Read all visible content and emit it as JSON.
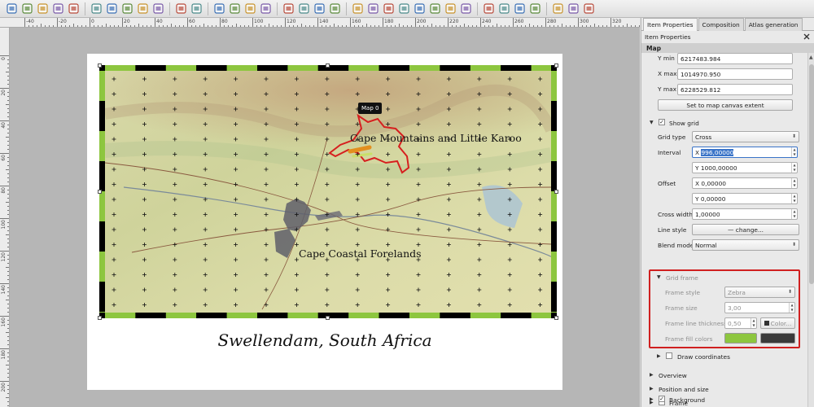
{
  "toolbar": {
    "icons": [
      "save-icon",
      "new-composer-icon",
      "duplicate-composer-icon",
      "composer-manager-icon",
      "load-template-icon",
      "save-template-icon",
      "print-icon",
      "export-image-icon",
      "export-svg-icon",
      "export-pdf-icon",
      "undo-icon",
      "redo-icon",
      "zoom-full-icon",
      "zoom-in-icon",
      "zoom-out-icon",
      "refresh-icon",
      "pan-icon",
      "zoom-tool-icon",
      "select-move-icon",
      "move-content-icon",
      "add-map-icon",
      "add-image-icon",
      "add-label-icon",
      "add-legend-icon",
      "add-scalebar-icon",
      "add-shape-icon",
      "add-arrow-icon",
      "add-table-icon",
      "group-icon",
      "ungroup-icon",
      "lock-icon",
      "unlock-icon",
      "raise-icon",
      "align-icon",
      "overflow-icon"
    ]
  },
  "ruler_top": {
    "labels": [
      "-40",
      "-20",
      "0",
      "20",
      "40",
      "60",
      "80",
      "100",
      "120",
      "140",
      "160",
      "180",
      "200",
      "220",
      "240",
      "260",
      "280",
      "300",
      "320"
    ]
  },
  "ruler_left": {
    "labels": [
      "0",
      "20",
      "40",
      "60",
      "80",
      "100",
      "120",
      "140",
      "160",
      "180",
      "200"
    ]
  },
  "map": {
    "tooltip": "Map 0",
    "label_mountains": "Cape Mountains and Little Karoo",
    "label_forelands": "Cape Coastal Forelands",
    "caption": "Swellendam, South Africa",
    "frame_color": "#8dc63f",
    "frame_dark": "#000000"
  },
  "panel": {
    "tabs": [
      "Item Properties",
      "Composition",
      "Atlas generation"
    ],
    "title": "Item Properties",
    "section": "Map",
    "ymin_label": "Y min",
    "ymin_value": "6217483.984",
    "xmax_label": "X max",
    "xmax_value": "1014970.950",
    "ymax_label": "Y max",
    "ymax_value": "6228529.812",
    "set_extent_button": "Set to map canvas extent",
    "show_grid_label": "Show grid",
    "grid_type_label": "Grid type",
    "grid_type_value": "Cross",
    "interval_label": "Interval",
    "interval_x_prefix": "X",
    "interval_x_value": "996,00000",
    "interval_y_value": "Y 1000,00000",
    "offset_label": "Offset",
    "offset_x_value": "X 0,00000",
    "offset_y_value": "Y 0,00000",
    "cross_width_label": "Cross width",
    "cross_width_value": "1,00000",
    "line_style_label": "Line style",
    "line_style_button": "change...",
    "blend_mode_label": "Blend mode",
    "blend_mode_value": "Normal",
    "grid_frame_label": "Grid frame",
    "frame_style_label": "Frame style",
    "frame_style_value": "Zebra",
    "frame_size_label": "Frame size",
    "frame_size_value": "3,00",
    "frame_line_thickness_label": "Frame line thickness",
    "frame_line_thickness_value": "0,50",
    "frame_line_color_button": "Color...",
    "frame_fill_colors_label": "Frame fill colors",
    "fill_color_1": "#8dc63f",
    "fill_color_2": "#3a3a3a",
    "draw_coordinates_label": "Draw coordinates",
    "overview_label": "Overview",
    "position_size_label": "Position and size",
    "frame_label": "Frame",
    "background_label": "Background"
  }
}
